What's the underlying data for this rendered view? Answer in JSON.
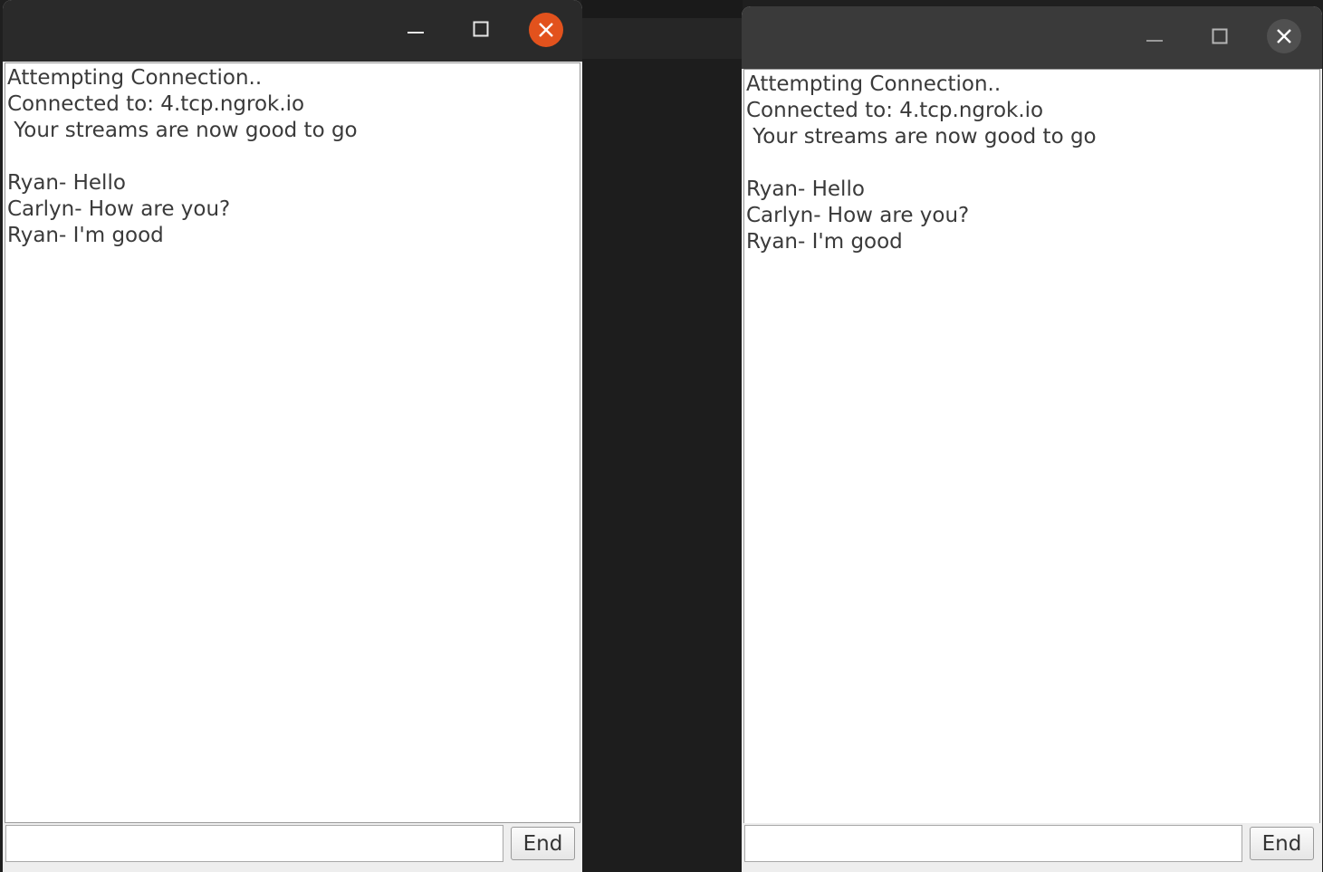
{
  "windows": [
    {
      "log": [
        "Attempting Connection..",
        "Connected to: 4.tcp.ngrok.io",
        " Your streams are now good to go",
        "",
        "Ryan- Hello",
        "Carlyn- How are you?",
        "Ryan- I'm good"
      ],
      "input_value": "",
      "end_label": "End",
      "close_color": "#e2521d"
    },
    {
      "log": [
        "Attempting Connection..",
        "Connected to: 4.tcp.ngrok.io",
        " Your streams are now good to go",
        "",
        "Ryan- Hello",
        "Carlyn- How are you?",
        "Ryan- I'm good"
      ],
      "input_value": "",
      "end_label": "End",
      "close_color": "#505050"
    }
  ],
  "icons": {
    "minimize": "minimize-icon",
    "maximize": "maximize-icon",
    "close": "close-icon"
  }
}
